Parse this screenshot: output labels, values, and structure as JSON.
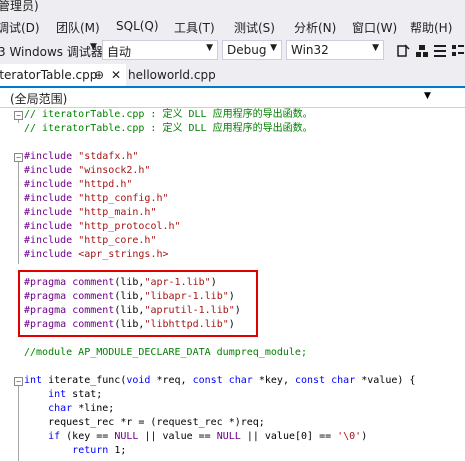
{
  "window": {
    "title": "管理员)"
  },
  "menu": [
    {
      "label": "调试(D)",
      "x": 0
    },
    {
      "label": "团队(M)",
      "x": 0
    },
    {
      "label": "SQL(Q)",
      "x": 0
    },
    {
      "label": "工具(T)",
      "x": 0
    },
    {
      "label": "测试(S)",
      "x": 0
    },
    {
      "label": "分析(N)",
      "x": 0
    },
    {
      "label": "窗口(W)",
      "x": 0
    },
    {
      "label": "帮助(H)",
      "x": 0
    }
  ],
  "toolbar": {
    "debugger_label": "3 Windows 调试器",
    "auto_combo": "自动",
    "config_combo": "Debug",
    "platform_combo": "Win32"
  },
  "tabs": [
    {
      "label": "iteratorTable.cpp",
      "pin": "⊕",
      "close": "✕"
    },
    {
      "label": "helloworld.cpp"
    }
  ],
  "navbar": {
    "scope": "(全局范围)"
  },
  "code": {
    "lines": [
      {
        "parts": [
          {
            "c": "cmt",
            "t": "// iteratorTable.cpp : 定义 DLL 应用程序的导出函数。"
          }
        ]
      },
      {
        "parts": [
          {
            "c": "cmt",
            "t": "// iteratorTable.cpp : 定义 DLL 应用程序的导出函数。"
          }
        ]
      },
      {
        "parts": []
      },
      {
        "parts": [
          {
            "c": "pp",
            "t": "#include"
          },
          {
            "c": "",
            "t": " "
          },
          {
            "c": "str",
            "t": "\"stdafx.h\""
          }
        ]
      },
      {
        "parts": [
          {
            "c": "pp",
            "t": "#include"
          },
          {
            "c": "",
            "t": " "
          },
          {
            "c": "str",
            "t": "\"winsock2.h\""
          }
        ]
      },
      {
        "parts": [
          {
            "c": "pp",
            "t": "#include"
          },
          {
            "c": "",
            "t": " "
          },
          {
            "c": "str",
            "t": "\"httpd.h\""
          }
        ]
      },
      {
        "parts": [
          {
            "c": "pp",
            "t": "#include"
          },
          {
            "c": "",
            "t": " "
          },
          {
            "c": "str",
            "t": "\"http_config.h\""
          }
        ]
      },
      {
        "parts": [
          {
            "c": "pp",
            "t": "#include"
          },
          {
            "c": "",
            "t": " "
          },
          {
            "c": "str",
            "t": "\"http_main.h\""
          }
        ]
      },
      {
        "parts": [
          {
            "c": "pp",
            "t": "#include"
          },
          {
            "c": "",
            "t": " "
          },
          {
            "c": "str",
            "t": "\"http_protocol.h\""
          }
        ]
      },
      {
        "parts": [
          {
            "c": "pp",
            "t": "#include"
          },
          {
            "c": "",
            "t": " "
          },
          {
            "c": "str",
            "t": "\"http_core.h\""
          }
        ]
      },
      {
        "parts": [
          {
            "c": "pp",
            "t": "#include"
          },
          {
            "c": "",
            "t": " "
          },
          {
            "c": "str",
            "t": "<apr_strings.h>"
          }
        ]
      },
      {
        "parts": []
      },
      {
        "parts": [
          {
            "c": "pp",
            "t": "#pragma"
          },
          {
            "c": "",
            "t": " "
          },
          {
            "c": "pp",
            "t": "comment"
          },
          {
            "c": "",
            "t": "(lib,"
          },
          {
            "c": "str",
            "t": "\"apr-1.lib\""
          },
          {
            "c": "",
            "t": ")"
          }
        ]
      },
      {
        "parts": [
          {
            "c": "pp",
            "t": "#pragma"
          },
          {
            "c": "",
            "t": " "
          },
          {
            "c": "pp",
            "t": "comment"
          },
          {
            "c": "",
            "t": "(lib,"
          },
          {
            "c": "str",
            "t": "\"libapr-1.lib\""
          },
          {
            "c": "",
            "t": ")"
          }
        ]
      },
      {
        "parts": [
          {
            "c": "pp",
            "t": "#pragma"
          },
          {
            "c": "",
            "t": " "
          },
          {
            "c": "pp",
            "t": "comment"
          },
          {
            "c": "",
            "t": "(lib,"
          },
          {
            "c": "str",
            "t": "\"aprutil-1.lib\""
          },
          {
            "c": "",
            "t": ")"
          }
        ]
      },
      {
        "parts": [
          {
            "c": "pp",
            "t": "#pragma"
          },
          {
            "c": "",
            "t": " "
          },
          {
            "c": "pp",
            "t": "comment"
          },
          {
            "c": "",
            "t": "(lib,"
          },
          {
            "c": "str",
            "t": "\"libhttpd.lib\""
          },
          {
            "c": "",
            "t": ")"
          }
        ]
      },
      {
        "parts": []
      },
      {
        "parts": [
          {
            "c": "cmt",
            "t": "//module AP_MODULE_DECLARE_DATA dumpreq_module;"
          }
        ]
      },
      {
        "parts": []
      },
      {
        "parts": [
          {
            "c": "kw",
            "t": "int"
          },
          {
            "c": "",
            "t": " iterate_func("
          },
          {
            "c": "kw",
            "t": "void"
          },
          {
            "c": "",
            "t": " *req, "
          },
          {
            "c": "kw",
            "t": "const"
          },
          {
            "c": "",
            "t": " "
          },
          {
            "c": "kw",
            "t": "char"
          },
          {
            "c": "",
            "t": " *key, "
          },
          {
            "c": "kw",
            "t": "const"
          },
          {
            "c": "",
            "t": " "
          },
          {
            "c": "kw",
            "t": "char"
          },
          {
            "c": "",
            "t": " *value) {"
          }
        ]
      },
      {
        "parts": [
          {
            "c": "",
            "t": "    "
          },
          {
            "c": "kw",
            "t": "int"
          },
          {
            "c": "",
            "t": " stat;"
          }
        ]
      },
      {
        "parts": [
          {
            "c": "",
            "t": "    "
          },
          {
            "c": "kw",
            "t": "char"
          },
          {
            "c": "",
            "t": " *line;"
          }
        ]
      },
      {
        "parts": [
          {
            "c": "",
            "t": "    request_rec *r = (request_rec *)req;"
          }
        ]
      },
      {
        "parts": [
          {
            "c": "",
            "t": "    "
          },
          {
            "c": "kw",
            "t": "if"
          },
          {
            "c": "",
            "t": " (key == "
          },
          {
            "c": "pp",
            "t": "NULL"
          },
          {
            "c": "",
            "t": " || value == "
          },
          {
            "c": "pp",
            "t": "NULL"
          },
          {
            "c": "",
            "t": " || value[0] == "
          },
          {
            "c": "str",
            "t": "'\\0'"
          },
          {
            "c": "",
            "t": ")"
          }
        ]
      },
      {
        "parts": [
          {
            "c": "",
            "t": "        "
          },
          {
            "c": "kw",
            "t": "return"
          },
          {
            "c": "",
            "t": " 1;"
          }
        ]
      }
    ]
  }
}
